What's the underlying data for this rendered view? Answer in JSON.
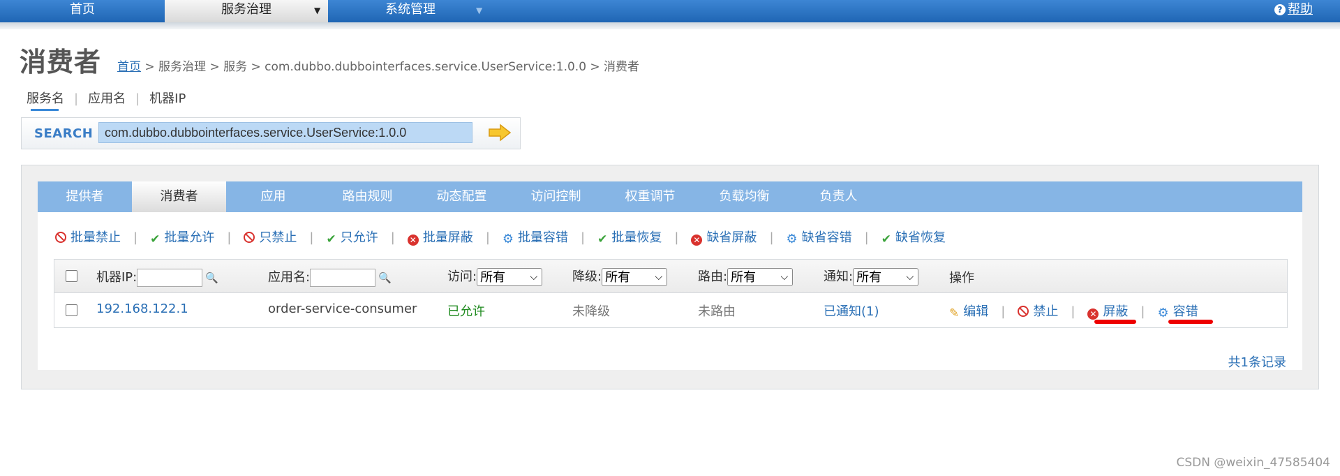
{
  "nav": {
    "items": [
      {
        "label": "首页"
      },
      {
        "label": "服务治理"
      },
      {
        "label": "系统管理"
      }
    ],
    "help_label": "帮助"
  },
  "page": {
    "title": "消费者",
    "breadcrumb": {
      "home": "首页",
      "rest": "> 服务治理 > 服务 > com.dubbo.dubbointerfaces.service.UserService:1.0.0 > 消费者"
    }
  },
  "search": {
    "tabs": [
      "服务名",
      "应用名",
      "机器IP"
    ],
    "label": "SEARCH",
    "value": "com.dubbo.dubbointerfaces.service.UserService:1.0.0"
  },
  "tabs": [
    "提供者",
    "消费者",
    "应用",
    "路由规则",
    "动态配置",
    "访问控制",
    "权重调节",
    "负载均衡",
    "负责人"
  ],
  "actions": [
    {
      "label": "批量禁止",
      "icon": "ban-icon"
    },
    {
      "label": "批量允许",
      "icon": "check-icon"
    },
    {
      "label": "只禁止",
      "icon": "ban-icon"
    },
    {
      "label": "只允许",
      "icon": "check-icon"
    },
    {
      "label": "批量屏蔽",
      "icon": "close-circle-icon"
    },
    {
      "label": "批量容错",
      "icon": "gear-icon"
    },
    {
      "label": "批量恢复",
      "icon": "check-icon"
    },
    {
      "label": "缺省屏蔽",
      "icon": "close-circle-icon"
    },
    {
      "label": "缺省容错",
      "icon": "gear-icon"
    },
    {
      "label": "缺省恢复",
      "icon": "check-icon"
    }
  ],
  "table": {
    "headers": {
      "ip": "机器IP:",
      "app": "应用名:",
      "access": "访问:",
      "degrade": "降级:",
      "route": "路由:",
      "notify": "通知:",
      "ops": "操作"
    },
    "select_value": "所有",
    "row": {
      "ip": "192.168.122.1",
      "app": "order-service-consumer",
      "access": "已允许",
      "degrade": "未降级",
      "route": "未路由",
      "notify": "已通知(1)",
      "ops": {
        "edit": "编辑",
        "forbid": "禁止",
        "shield": "屏蔽",
        "tolerance": "容错"
      }
    },
    "total": "共1条记录"
  },
  "watermark": "CSDN @weixin_47585404",
  "colors": {
    "nav": "#1f65b4",
    "tabbar": "#86b5e5",
    "link": "#2a6fb5",
    "allowed": "#1e8a1e",
    "marker": "#e00000"
  }
}
